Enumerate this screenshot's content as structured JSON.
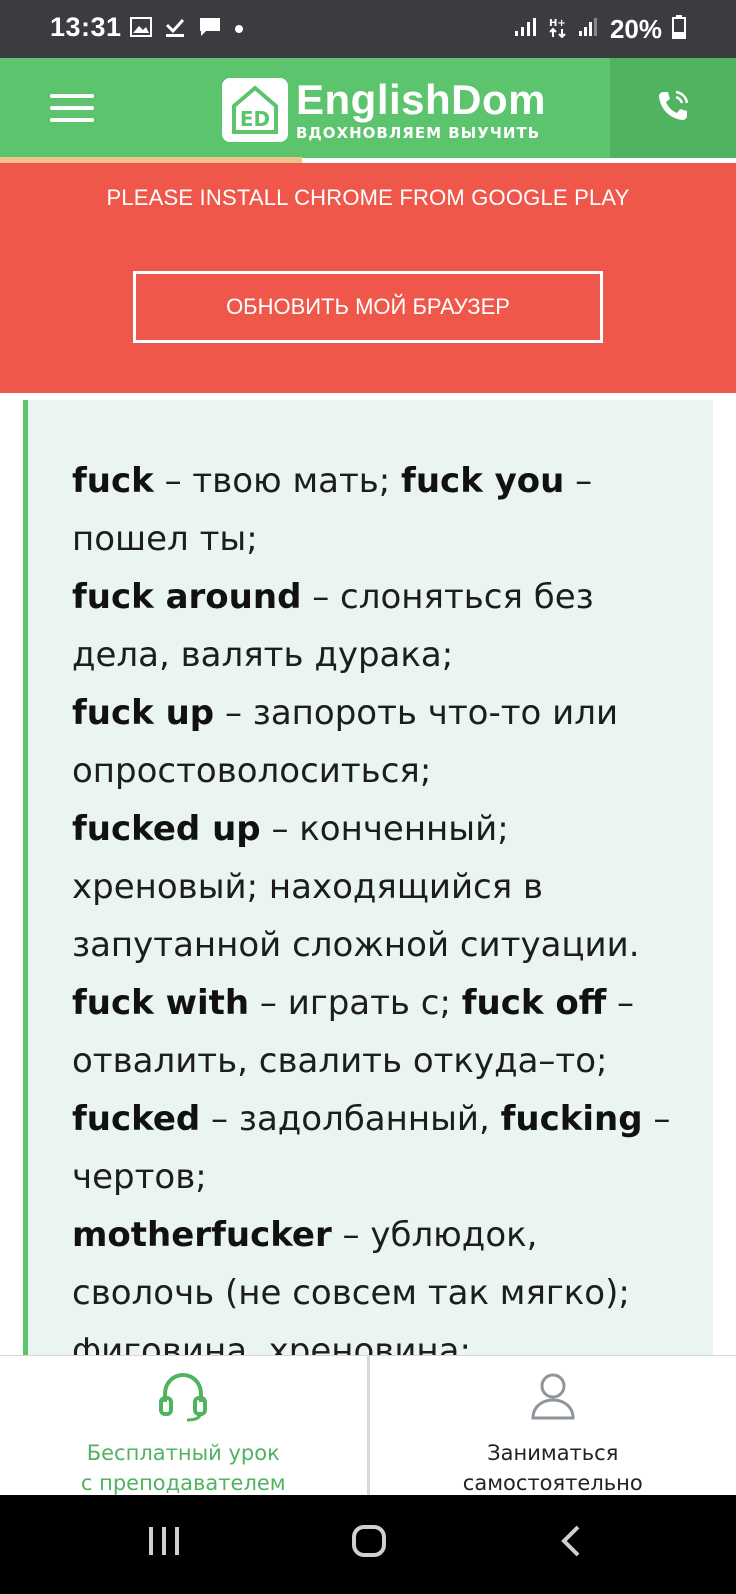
{
  "status_bar": {
    "time": "13:31",
    "battery": "20%",
    "icons": [
      "image-icon",
      "download-done-icon",
      "chat-icon",
      "dot-icon",
      "signal-icon",
      "network-icon",
      "signal-2-icon",
      "battery-icon"
    ]
  },
  "header": {
    "brand": "EnglishDom",
    "tagline": "ВДОХНОВЛЯЕМ ВЫУЧИТЬ",
    "logo_letters": "ED",
    "bg_color": "#5cc46d",
    "phone_bg_color": "#4fb360"
  },
  "banner": {
    "message": "PLEASE INSTALL CHROME FROM GOOGLE PLAY",
    "button_label": "ОБНОВИТЬ МОЙ БРАУЗЕР",
    "bg_color": "#f0574b"
  },
  "content": {
    "lines": [
      [
        {
          "t": "fuck",
          "b": true
        },
        {
          "t": " – твою мать; ",
          "b": false
        },
        {
          "t": "fuck you",
          "b": true
        },
        {
          "t": " –",
          "b": false
        }
      ],
      [
        {
          "t": "пошел ты;",
          "b": false
        }
      ],
      [
        {
          "t": "fuck around",
          "b": true
        },
        {
          "t": " – слоняться без",
          "b": false
        }
      ],
      [
        {
          "t": "дела, валять дурака;",
          "b": false
        }
      ],
      [
        {
          "t": "fuck up",
          "b": true
        },
        {
          "t": " – запороть что-то или",
          "b": false
        }
      ],
      [
        {
          "t": "опростоволоситься;",
          "b": false
        }
      ],
      [
        {
          "t": "fucked up",
          "b": true
        },
        {
          "t": " – конченный;",
          "b": false
        }
      ],
      [
        {
          "t": "хреновый; находящийся в",
          "b": false
        }
      ],
      [
        {
          "t": "запутанной сложной ситуации.",
          "b": false
        }
      ],
      [
        {
          "t": "fuck with",
          "b": true
        },
        {
          "t": " – играть с; ",
          "b": false
        },
        {
          "t": "fuck off",
          "b": true
        },
        {
          "t": " –",
          "b": false
        }
      ],
      [
        {
          "t": "отвалить, свалить откуда–то;",
          "b": false
        }
      ],
      [
        {
          "t": "fucked",
          "b": true
        },
        {
          "t": " – задолбанный, ",
          "b": false
        },
        {
          "t": "fucking",
          "b": true
        },
        {
          "t": " –",
          "b": false
        }
      ],
      [
        {
          "t": "чертов;",
          "b": false
        }
      ],
      [
        {
          "t": "motherfucker",
          "b": true
        },
        {
          "t": " – ублюдок,",
          "b": false
        }
      ],
      [
        {
          "t": "сволочь (не совсем так мягко);",
          "b": false
        }
      ],
      [
        {
          "t": "фиговина, хреновина;",
          "b": false
        }
      ]
    ]
  },
  "bottom_bar": {
    "free_lesson_line1": "Бесплатный урок",
    "free_lesson_line2": "с преподавателем",
    "self_study_line1": "Заниматься",
    "self_study_line2": "самостоятельно",
    "accent_color": "#4fb360"
  },
  "nav_bar": {
    "items": [
      "recents-icon",
      "home-icon",
      "back-icon"
    ]
  }
}
